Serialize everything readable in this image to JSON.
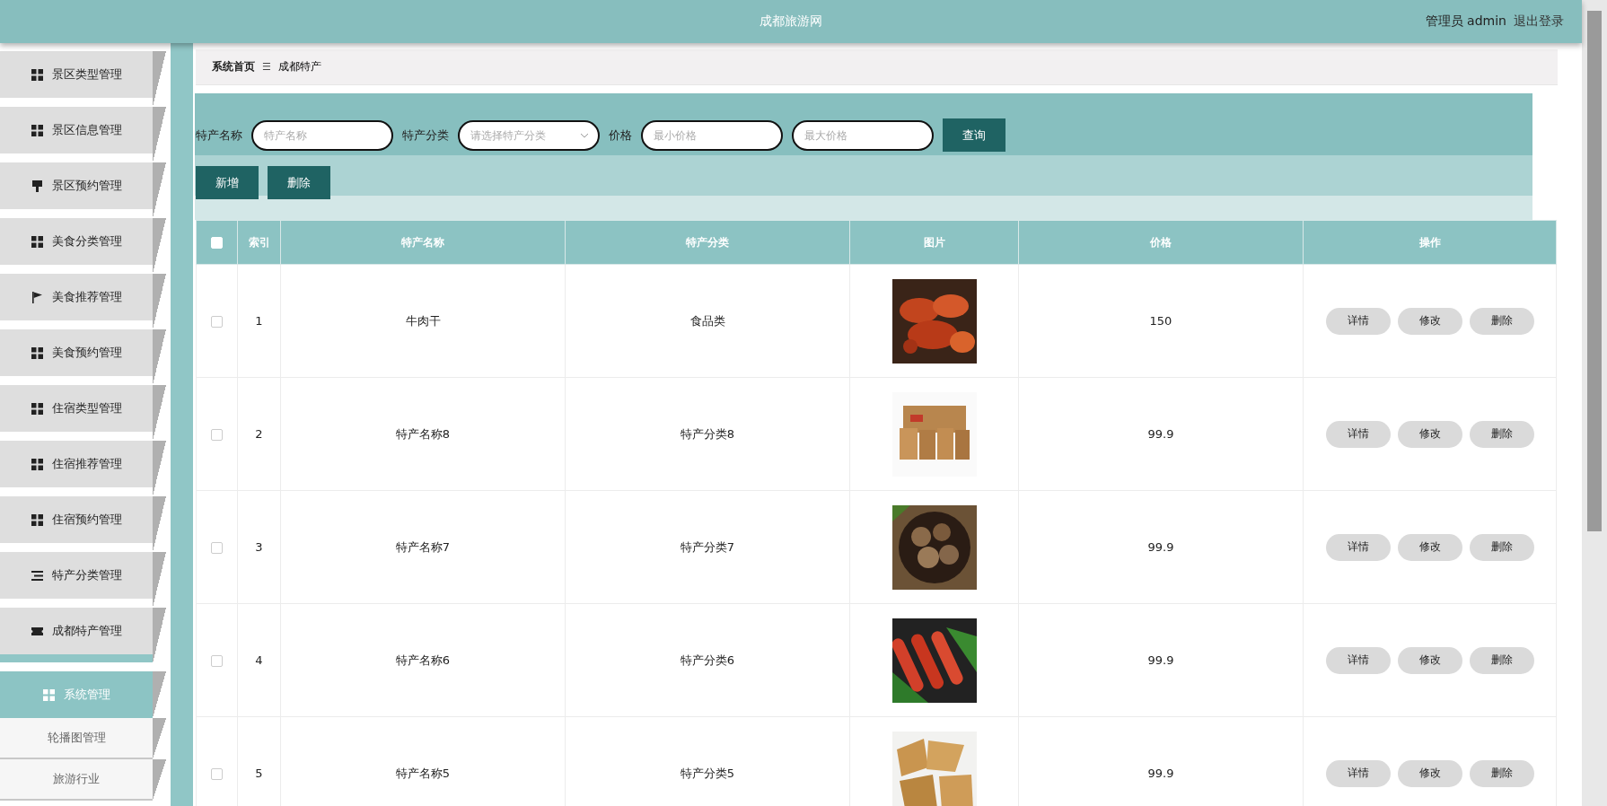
{
  "header": {
    "title": "成都旅游网",
    "user": "管理员 admin",
    "logout": "退出登录"
  },
  "sidebar": {
    "items": [
      {
        "label": "景区类型管理",
        "selected": false
      },
      {
        "label": "景区信息管理",
        "selected": false
      },
      {
        "label": "景区预约管理",
        "selected": false
      },
      {
        "label": "美食分类管理",
        "selected": false
      },
      {
        "label": "美食推荐管理",
        "selected": false
      },
      {
        "label": "美食预约管理",
        "selected": false
      },
      {
        "label": "住宿类型管理",
        "selected": false
      },
      {
        "label": "住宿推荐管理",
        "selected": false
      },
      {
        "label": "住宿预约管理",
        "selected": false
      },
      {
        "label": "特产分类管理",
        "selected": false
      },
      {
        "label": "成都特产管理",
        "selected": false
      },
      {
        "label": "系统管理",
        "selected": true,
        "children": [
          {
            "label": "轮播图管理"
          },
          {
            "label": "旅游行业"
          }
        ]
      }
    ]
  },
  "breadcrumb": {
    "home": "系统首页",
    "separator": "☰",
    "current": "成都特产"
  },
  "filters": [
    {
      "kind": "input",
      "label": "特产名称",
      "placeholder": "特产名称"
    },
    {
      "kind": "select",
      "label": "特产分类",
      "placeholder": "请选择特产分类"
    },
    {
      "kind": "input",
      "label": "价格",
      "placeholder": "最小价格"
    },
    {
      "kind": "input",
      "placeholder": "最大价格"
    }
  ],
  "search_button": "查询",
  "actions": [
    "新增",
    "删除"
  ],
  "table": {
    "columns": [
      "索引",
      "特产名称",
      "特产分类",
      "图片",
      "价格",
      "操作"
    ],
    "select_all": false,
    "rows": [
      {
        "checked": false,
        "index": "1",
        "name": "牛肉干",
        "category": "食品类",
        "price": "150",
        "actions": [
          "详情",
          "修改",
          "删除"
        ]
      },
      {
        "checked": false,
        "index": "2",
        "name": "特产名称8",
        "category": "特产分类8",
        "price": "99.9",
        "actions": [
          "详情",
          "修改",
          "删除"
        ]
      },
      {
        "checked": false,
        "index": "3",
        "name": "特产名称7",
        "category": "特产分类7",
        "price": "99.9",
        "actions": [
          "详情",
          "修改",
          "删除"
        ]
      },
      {
        "checked": false,
        "index": "4",
        "name": "特产名称6",
        "category": "特产分类6",
        "price": "99.9",
        "actions": [
          "详情",
          "修改",
          "删除"
        ]
      },
      {
        "checked": false,
        "index": "5",
        "name": "特产名称5",
        "category": "特产分类5",
        "price": "99.9",
        "actions": [
          "详情",
          "修改",
          "删除"
        ]
      }
    ]
  }
}
